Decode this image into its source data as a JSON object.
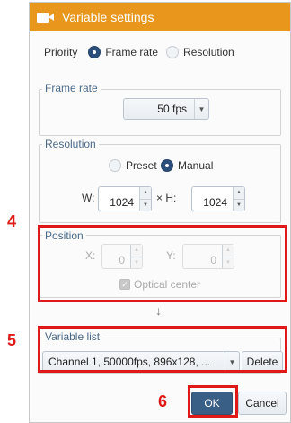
{
  "window": {
    "title": "Variable settings"
  },
  "priority": {
    "label": "Priority",
    "option1": "Frame rate",
    "option2": "Resolution",
    "selected": "Frame rate"
  },
  "frame_rate": {
    "group_label": "Frame rate",
    "value": "50 fps"
  },
  "resolution": {
    "group_label": "Resolution",
    "option1": "Preset",
    "option2": "Manual",
    "selected": "Manual",
    "w_label": "W:",
    "w_value": "1024",
    "h_label": "× H:",
    "h_value": "1024"
  },
  "position": {
    "group_label": "Position",
    "x_label": "X:",
    "x_value": "0",
    "y_label": "Y:",
    "y_value": "0",
    "optical_center_label": "Optical center"
  },
  "variable_list": {
    "group_label": "Variable list",
    "selected": "Channel 1, 50000fps, 896x128, ...",
    "delete_label": "Delete"
  },
  "actions": {
    "ok_label": "OK",
    "cancel_label": "Cancel"
  },
  "annotations": {
    "marker4": "4",
    "marker5": "5",
    "marker6": "6"
  },
  "colors": {
    "titlebar": "#e8961c",
    "highlight": "#e01818",
    "ok_button": "#3a5f86"
  },
  "icons": {
    "title": "camera-icon",
    "down_arrow": "down-arrow-icon"
  }
}
